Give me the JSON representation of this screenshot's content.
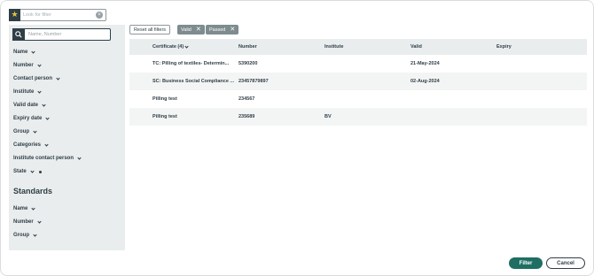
{
  "top_search": {
    "placeholder": "Look for filter",
    "icon": "star-icon"
  },
  "sidebar": {
    "search_placeholder": "Name, Number",
    "filters": [
      {
        "label": "Name"
      },
      {
        "label": "Number"
      },
      {
        "label": "Contact person"
      },
      {
        "label": "Institute"
      },
      {
        "label": "Valid date"
      },
      {
        "label": "Expiry date"
      },
      {
        "label": "Group"
      },
      {
        "label": "Categories"
      },
      {
        "label": "Institute contact person"
      },
      {
        "label": "State"
      }
    ],
    "section_title": "Standards",
    "standards_filters": [
      {
        "label": "Name"
      },
      {
        "label": "Number"
      },
      {
        "label": "Group"
      }
    ]
  },
  "chips": {
    "reset_label": "Reset all filters",
    "active": [
      {
        "label": "Valid"
      },
      {
        "label": "Passed"
      }
    ]
  },
  "table": {
    "headers": {
      "certificate": "Certificate (4)",
      "number": "Number",
      "institute": "Institute",
      "valid": "Valid",
      "expiry": "Expiry"
    },
    "rows": [
      {
        "certificate": "TC: Pilling of textiles- Determin...",
        "number": "5390200",
        "institute": "",
        "valid": "21-May-2024",
        "expiry": ""
      },
      {
        "certificate": "SC: Business Social Compliance ...",
        "number": "23457879897",
        "institute": "",
        "valid": "02-Aug-2024",
        "expiry": ""
      },
      {
        "certificate": "Pilling test",
        "number": "234567",
        "institute": "",
        "valid": "",
        "expiry": ""
      },
      {
        "certificate": "Pilling test",
        "number": "235689",
        "institute": "BV",
        "valid": "",
        "expiry": ""
      }
    ]
  },
  "footer": {
    "filter_label": "Filter",
    "cancel_label": "Cancel"
  },
  "colors": {
    "primary": "#1f6e63",
    "dark": "#2f3e46",
    "sidebar_bg": "#e9edee",
    "chip_bg": "#7e8c90",
    "star": "#e8c33a"
  }
}
